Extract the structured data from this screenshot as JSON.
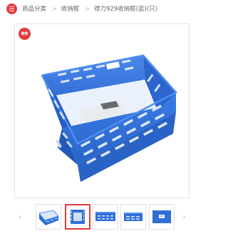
{
  "breadcrumb": {
    "menu_icon": "list-icon",
    "items": [
      "商品分类",
      "收纳框",
      "得力929收纳框(蓝)(只)"
    ],
    "separator": ">"
  },
  "product_image": {
    "badge": "推荐",
    "alt": "得力929收纳框(蓝)(只)"
  },
  "gallery": {
    "prev_icon": "chevron-left-icon",
    "next_icon": "chevron-right-icon",
    "thumbnail_count": 5,
    "active_index": 1
  },
  "colors": {
    "accent": "#e4393c",
    "basket_blue": "#2d6fd8",
    "text": "#666666"
  }
}
